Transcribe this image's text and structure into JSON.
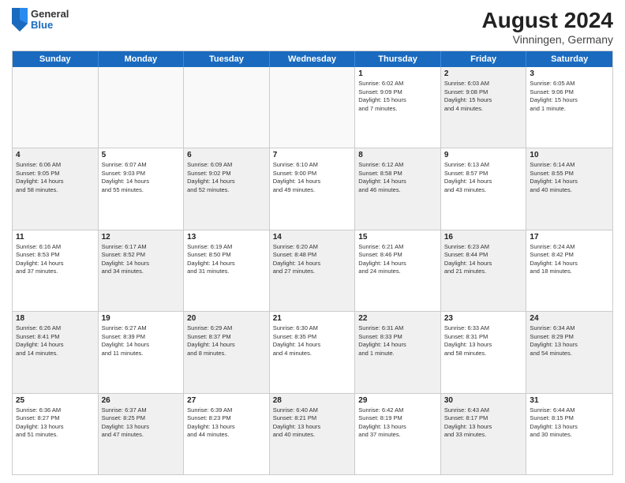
{
  "header": {
    "logo": {
      "general": "General",
      "blue": "Blue"
    },
    "month_year": "August 2024",
    "location": "Vinningen, Germany"
  },
  "days_of_week": [
    "Sunday",
    "Monday",
    "Tuesday",
    "Wednesday",
    "Thursday",
    "Friday",
    "Saturday"
  ],
  "weeks": [
    [
      {
        "day": "",
        "info": "",
        "empty": true
      },
      {
        "day": "",
        "info": "",
        "empty": true
      },
      {
        "day": "",
        "info": "",
        "empty": true
      },
      {
        "day": "",
        "info": "",
        "empty": true
      },
      {
        "day": "1",
        "info": "Sunrise: 6:02 AM\nSunset: 9:09 PM\nDaylight: 15 hours\nand 7 minutes.",
        "shaded": false
      },
      {
        "day": "2",
        "info": "Sunrise: 6:03 AM\nSunset: 9:08 PM\nDaylight: 15 hours\nand 4 minutes.",
        "shaded": true
      },
      {
        "day": "3",
        "info": "Sunrise: 6:05 AM\nSunset: 9:06 PM\nDaylight: 15 hours\nand 1 minute.",
        "shaded": false
      }
    ],
    [
      {
        "day": "4",
        "info": "Sunrise: 6:06 AM\nSunset: 9:05 PM\nDaylight: 14 hours\nand 58 minutes.",
        "shaded": true
      },
      {
        "day": "5",
        "info": "Sunrise: 6:07 AM\nSunset: 9:03 PM\nDaylight: 14 hours\nand 55 minutes.",
        "shaded": false
      },
      {
        "day": "6",
        "info": "Sunrise: 6:09 AM\nSunset: 9:02 PM\nDaylight: 14 hours\nand 52 minutes.",
        "shaded": true
      },
      {
        "day": "7",
        "info": "Sunrise: 6:10 AM\nSunset: 9:00 PM\nDaylight: 14 hours\nand 49 minutes.",
        "shaded": false
      },
      {
        "day": "8",
        "info": "Sunrise: 6:12 AM\nSunset: 8:58 PM\nDaylight: 14 hours\nand 46 minutes.",
        "shaded": true
      },
      {
        "day": "9",
        "info": "Sunrise: 6:13 AM\nSunset: 8:57 PM\nDaylight: 14 hours\nand 43 minutes.",
        "shaded": false
      },
      {
        "day": "10",
        "info": "Sunrise: 6:14 AM\nSunset: 8:55 PM\nDaylight: 14 hours\nand 40 minutes.",
        "shaded": true
      }
    ],
    [
      {
        "day": "11",
        "info": "Sunrise: 6:16 AM\nSunset: 8:53 PM\nDaylight: 14 hours\nand 37 minutes.",
        "shaded": false
      },
      {
        "day": "12",
        "info": "Sunrise: 6:17 AM\nSunset: 8:52 PM\nDaylight: 14 hours\nand 34 minutes.",
        "shaded": true
      },
      {
        "day": "13",
        "info": "Sunrise: 6:19 AM\nSunset: 8:50 PM\nDaylight: 14 hours\nand 31 minutes.",
        "shaded": false
      },
      {
        "day": "14",
        "info": "Sunrise: 6:20 AM\nSunset: 8:48 PM\nDaylight: 14 hours\nand 27 minutes.",
        "shaded": true
      },
      {
        "day": "15",
        "info": "Sunrise: 6:21 AM\nSunset: 8:46 PM\nDaylight: 14 hours\nand 24 minutes.",
        "shaded": false
      },
      {
        "day": "16",
        "info": "Sunrise: 6:23 AM\nSunset: 8:44 PM\nDaylight: 14 hours\nand 21 minutes.",
        "shaded": true
      },
      {
        "day": "17",
        "info": "Sunrise: 6:24 AM\nSunset: 8:42 PM\nDaylight: 14 hours\nand 18 minutes.",
        "shaded": false
      }
    ],
    [
      {
        "day": "18",
        "info": "Sunrise: 6:26 AM\nSunset: 8:41 PM\nDaylight: 14 hours\nand 14 minutes.",
        "shaded": true
      },
      {
        "day": "19",
        "info": "Sunrise: 6:27 AM\nSunset: 8:39 PM\nDaylight: 14 hours\nand 11 minutes.",
        "shaded": false
      },
      {
        "day": "20",
        "info": "Sunrise: 6:29 AM\nSunset: 8:37 PM\nDaylight: 14 hours\nand 8 minutes.",
        "shaded": true
      },
      {
        "day": "21",
        "info": "Sunrise: 6:30 AM\nSunset: 8:35 PM\nDaylight: 14 hours\nand 4 minutes.",
        "shaded": false
      },
      {
        "day": "22",
        "info": "Sunrise: 6:31 AM\nSunset: 8:33 PM\nDaylight: 14 hours\nand 1 minute.",
        "shaded": true
      },
      {
        "day": "23",
        "info": "Sunrise: 6:33 AM\nSunset: 8:31 PM\nDaylight: 13 hours\nand 58 minutes.",
        "shaded": false
      },
      {
        "day": "24",
        "info": "Sunrise: 6:34 AM\nSunset: 8:29 PM\nDaylight: 13 hours\nand 54 minutes.",
        "shaded": true
      }
    ],
    [
      {
        "day": "25",
        "info": "Sunrise: 6:36 AM\nSunset: 8:27 PM\nDaylight: 13 hours\nand 51 minutes.",
        "shaded": false
      },
      {
        "day": "26",
        "info": "Sunrise: 6:37 AM\nSunset: 8:25 PM\nDaylight: 13 hours\nand 47 minutes.",
        "shaded": true
      },
      {
        "day": "27",
        "info": "Sunrise: 6:39 AM\nSunset: 8:23 PM\nDaylight: 13 hours\nand 44 minutes.",
        "shaded": false
      },
      {
        "day": "28",
        "info": "Sunrise: 6:40 AM\nSunset: 8:21 PM\nDaylight: 13 hours\nand 40 minutes.",
        "shaded": true
      },
      {
        "day": "29",
        "info": "Sunrise: 6:42 AM\nSunset: 8:19 PM\nDaylight: 13 hours\nand 37 minutes.",
        "shaded": false
      },
      {
        "day": "30",
        "info": "Sunrise: 6:43 AM\nSunset: 8:17 PM\nDaylight: 13 hours\nand 33 minutes.",
        "shaded": true
      },
      {
        "day": "31",
        "info": "Sunrise: 6:44 AM\nSunset: 8:15 PM\nDaylight: 13 hours\nand 30 minutes.",
        "shaded": false
      }
    ]
  ]
}
